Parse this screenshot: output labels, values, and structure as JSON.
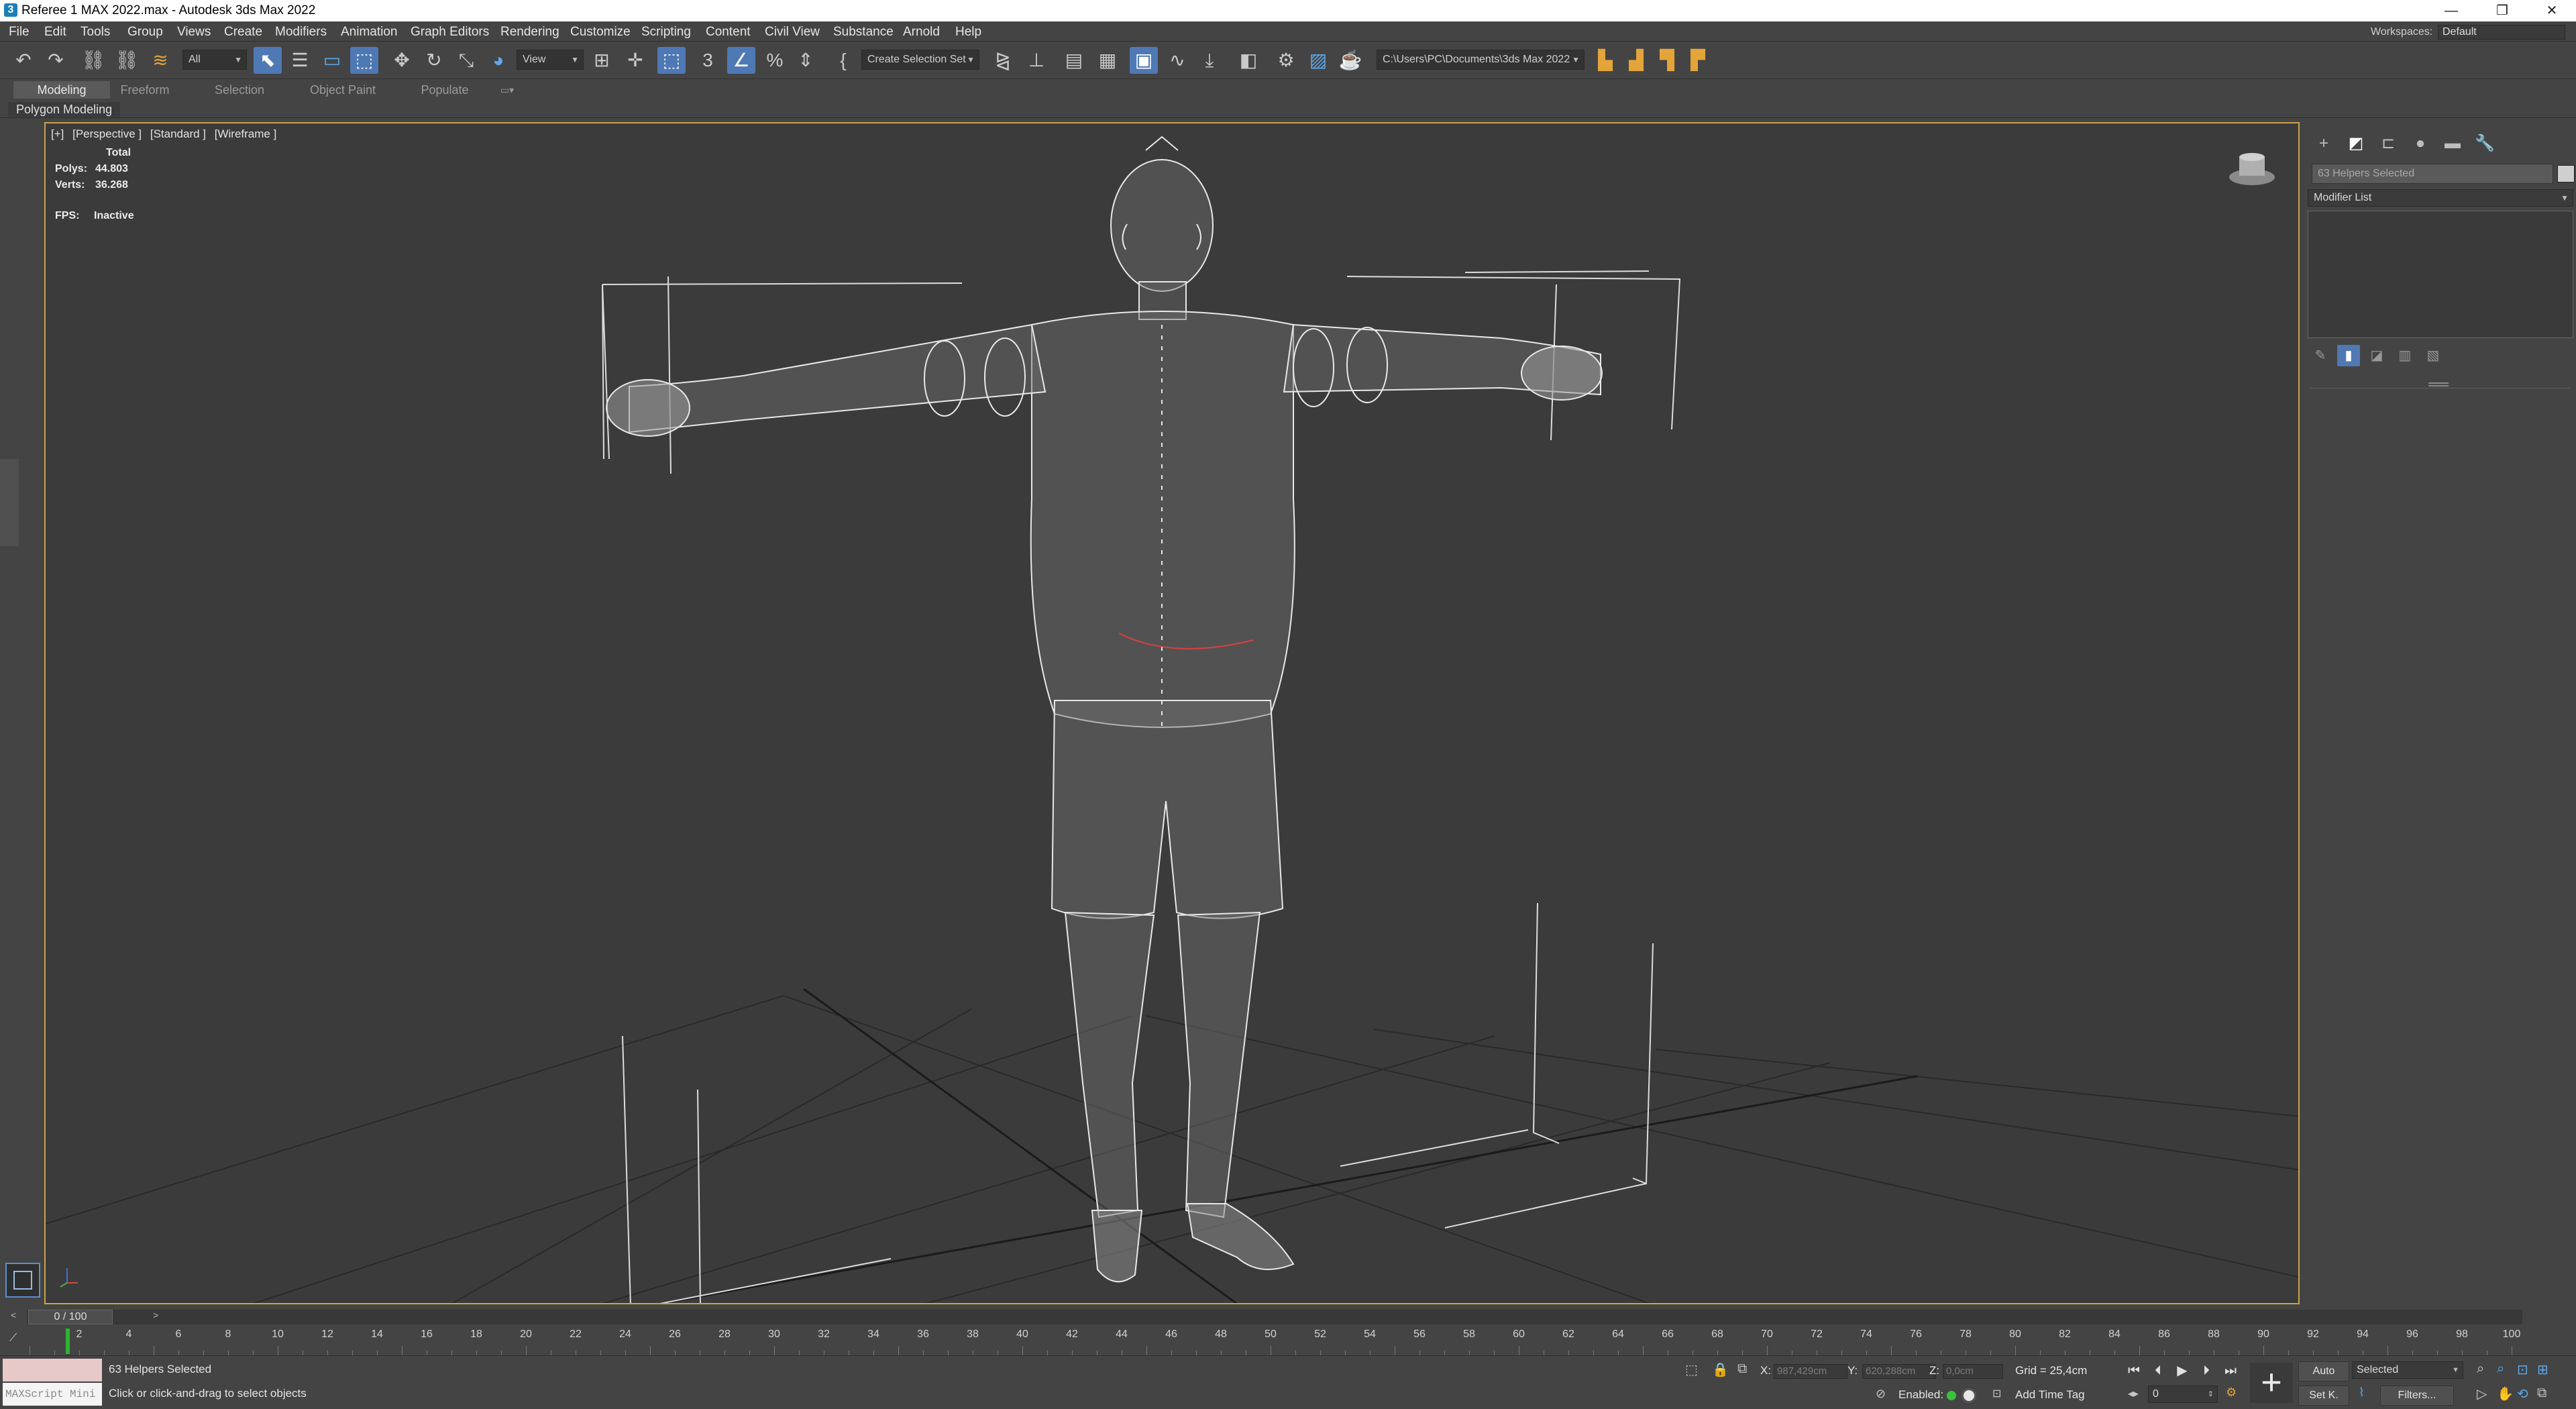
{
  "window": {
    "title": "Referee 1 MAX 2022.max - Autodesk 3ds Max 2022",
    "minimize": "—",
    "restore": "❐",
    "close": "✕"
  },
  "menu": [
    "File",
    "Edit",
    "Tools",
    "Group",
    "Views",
    "Create",
    "Modifiers",
    "Animation",
    "Graph Editors",
    "Rendering",
    "Customize",
    "Scripting",
    "Content",
    "Civil View",
    "Substance",
    "Arnold",
    "Help"
  ],
  "workspaces": {
    "label": "Workspaces:",
    "value": "Default"
  },
  "toolbar": {
    "selection_filter": "All",
    "ref_coord": "View",
    "selection_set": "Create Selection Set",
    "project_path": "C:\\Users\\PC\\Documents\\3ds Max 2022"
  },
  "ribbon": {
    "tabs": [
      "Modeling",
      "Freeform",
      "Selection",
      "Object Paint",
      "Populate"
    ],
    "active_tab": "Modeling",
    "panel_label": "Polygon Modeling"
  },
  "viewport": {
    "labels": [
      "[+]",
      "[Perspective ]",
      "[Standard ]",
      "[Wireframe ]"
    ],
    "stats": {
      "header": "Total",
      "polys_label": "Polys:",
      "polys": "44.803",
      "verts_label": "Verts:",
      "verts": "36.268",
      "fps_label": "FPS:",
      "fps": "Inactive"
    },
    "colors": {
      "border": "#c9a34a",
      "background": "#3b3b3b",
      "wire": "#e8e8e8",
      "grid": "#1e1e1e"
    }
  },
  "command_panel": {
    "selection_name": "63 Helpers Selected",
    "modifier_list": "Modifier List"
  },
  "time_slider": {
    "value": "0 / 100",
    "prev": "<",
    "next": ">"
  },
  "trackbar": {
    "ticks": [
      0,
      2,
      4,
      6,
      8,
      10,
      12,
      14,
      16,
      18,
      20,
      22,
      24,
      26,
      28,
      30,
      32,
      34,
      36,
      38,
      40,
      42,
      44,
      46,
      48,
      50,
      52,
      54,
      56,
      58,
      60,
      62,
      64,
      66,
      68,
      70,
      72,
      74,
      76,
      78,
      80,
      82,
      84,
      86,
      88,
      90,
      92,
      94,
      96,
      98,
      100
    ],
    "max": 100
  },
  "status": {
    "maxscript": "MAXScript Mini",
    "selected": "63 Helpers Selected",
    "prompt": "Click or click-and-drag to select objects",
    "x_label": "X:",
    "x": "987,429cm",
    "y_label": "Y:",
    "y": "620,288cm",
    "z_label": "Z:",
    "z": "0,0cm",
    "grid": "Grid = 25,4cm",
    "enabled": "Enabled:",
    "add_time_tag": "Add Time Tag",
    "auto": "Auto",
    "set_key": "Set K.",
    "key_mode": "Selected",
    "frame": "0",
    "filters": "Filters..."
  }
}
